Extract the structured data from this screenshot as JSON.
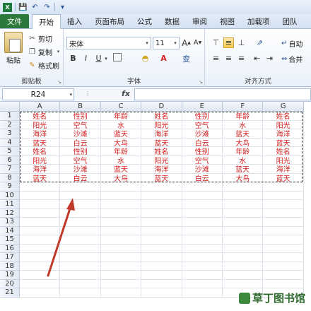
{
  "tabs": {
    "file": "文件",
    "items": [
      "开始",
      "插入",
      "页面布局",
      "公式",
      "数据",
      "审阅",
      "视图",
      "加载项",
      "团队"
    ],
    "active_index": 0
  },
  "clipboard": {
    "paste_label": "粘贴",
    "cut_label": "剪切",
    "copy_label": "复制",
    "format_painter_label": "格式刷",
    "group_label": "剪贴板"
  },
  "font": {
    "font_name": "宋体",
    "font_size": "11",
    "bold": "B",
    "italic": "I",
    "underline": "U",
    "grow": "A",
    "shrink": "A",
    "font_color_glyph": "A",
    "phonetic": "变",
    "group_label": "字体"
  },
  "alignment": {
    "group_label": "对齐方式",
    "wrap_label": "自动",
    "merge_label": "合并"
  },
  "formula_bar": {
    "name_box": "R24",
    "fx": "fx",
    "value": ""
  },
  "sheet": {
    "columns": [
      "A",
      "B",
      "C",
      "D",
      "E",
      "F",
      "G"
    ],
    "rows": [
      "1",
      "2",
      "3",
      "4",
      "5",
      "6",
      "7",
      "8",
      "9",
      "10",
      "11",
      "12",
      "13",
      "14",
      "15",
      "16",
      "17",
      "18",
      "19",
      "20",
      "21"
    ],
    "cells": [
      [
        "姓名",
        "性别",
        "年龄",
        "姓名",
        "性别",
        "年龄",
        "姓名"
      ],
      [
        "阳光",
        "空气",
        "水",
        "阳光",
        "空气",
        "水",
        "阳光"
      ],
      [
        "海洋",
        "沙滩",
        "蓝天",
        "海洋",
        "沙滩",
        "蓝天",
        "海洋"
      ],
      [
        "蓝天",
        "白云",
        "大鸟",
        "蓝天",
        "白云",
        "大鸟",
        "蓝天"
      ],
      [
        "姓名",
        "性别",
        "年龄",
        "姓名",
        "性别",
        "年龄",
        "姓名"
      ],
      [
        "阳光",
        "空气",
        "水",
        "阳光",
        "空气",
        "水",
        "阳光"
      ],
      [
        "海洋",
        "沙滩",
        "蓝天",
        "海洋",
        "沙滩",
        "蓝天",
        "海洋"
      ],
      [
        "蓝天",
        "白云",
        "大鸟",
        "蓝天",
        "白云",
        "大鸟",
        "蓝天"
      ]
    ],
    "text_color": "#d32020"
  },
  "watermark": {
    "text": "草丁图书馆"
  },
  "colors": {
    "file_tab": "#2b7a3b",
    "arrow": "#c0392b"
  }
}
